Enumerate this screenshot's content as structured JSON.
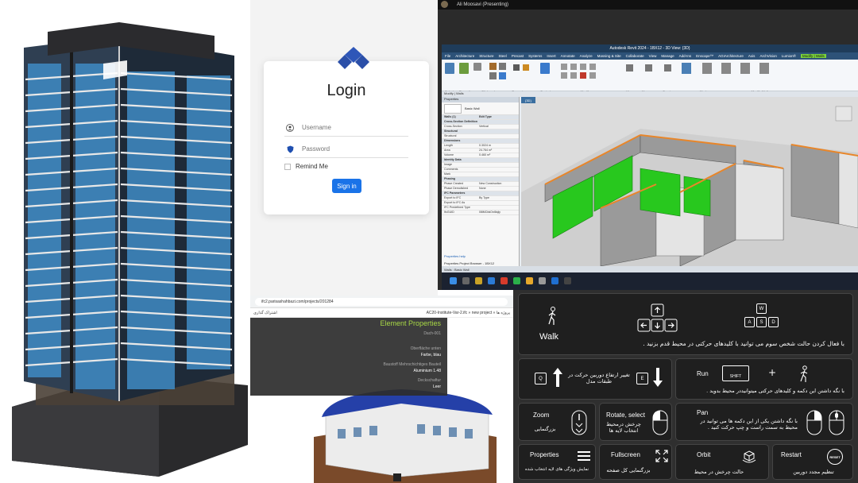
{
  "login": {
    "title": "Login",
    "username_placeholder": "Username",
    "password_placeholder": "Password",
    "remember_label": "Remind Me",
    "signin_label": "Sign in"
  },
  "meeting": {
    "presenter": "Ali Moosavi (Presenting)"
  },
  "revit": {
    "title": "Autodesk Revit 2024 - 1BX12 - 3D View: {3D}",
    "tabs": [
      "File",
      "Architecture",
      "Structure",
      "Steel",
      "Precast",
      "Systems",
      "Insert",
      "Annotate",
      "Analyze",
      "Massing & Site",
      "Collaborate",
      "View",
      "Manage",
      "Add-Ins",
      "Enscape™",
      "AGIArchitecture",
      "Axis",
      "ArchVision",
      "Lumion®",
      "Modify | Walls"
    ],
    "ribbon_groups": [
      "Select",
      "Properties",
      "Clipboard",
      "Geometry",
      "Controls",
      "Modify",
      "View",
      "Measure",
      "Create",
      "Mode",
      "Modify Wall"
    ],
    "subbar": "Modify | Walls",
    "view_tab": "{3D}",
    "properties_header": "Properties",
    "type_name": "Basic Wall",
    "property_rows": [
      {
        "k": "Walls (1)",
        "v": "Edit Type",
        "sec": true
      },
      {
        "k": "Cross-Section Definition",
        "v": "",
        "sec": true
      },
      {
        "k": "Cross-Section",
        "v": "Vertical",
        "sec": false
      },
      {
        "k": "Structural",
        "v": "",
        "sec": true
      },
      {
        "k": "Structural",
        "v": "",
        "sec": false
      },
      {
        "k": "Dimensions",
        "v": "",
        "sec": true
      },
      {
        "k": "Length",
        "v": "0.3024 m",
        "sec": false
      },
      {
        "k": "Area",
        "v": "24.764 m²",
        "sec": false
      },
      {
        "k": "Volume",
        "v": "0.460 m³",
        "sec": false
      },
      {
        "k": "Identity Data",
        "v": "",
        "sec": true
      },
      {
        "k": "Image",
        "v": "",
        "sec": false
      },
      {
        "k": "Comments",
        "v": "",
        "sec": false
      },
      {
        "k": "Mark",
        "v": "",
        "sec": false
      },
      {
        "k": "Phasing",
        "v": "",
        "sec": true
      },
      {
        "k": "Phase Created",
        "v": "New Construction",
        "sec": false
      },
      {
        "k": "Phase Demolished",
        "v": "None",
        "sec": false
      },
      {
        "k": "IFC Parameters",
        "v": "",
        "sec": true
      },
      {
        "k": "Export to IFC",
        "v": "By Type",
        "sec": false
      },
      {
        "k": "Export to IFC As",
        "v": "",
        "sec": false
      },
      {
        "k": "IFC Predefined Type",
        "v": "",
        "sec": false
      },
      {
        "k": "IfcGUID",
        "v": "0l8MCfaiOnl6sjiy",
        "sec": false
      }
    ],
    "properties_help": "Properties help",
    "bottom_tabs": "Properties   Project Browser - 1BX12",
    "status": "Walls : Basic Wall"
  },
  "viewer": {
    "url": "ifc2.parisashahbazi.com/projects/201284",
    "share_label": "اشتراک گذاری",
    "path": "AC20-Institute-Var-2.ifc » new project » پروژه ها",
    "panel_title": "Element Properties",
    "panel_subtitle": "Dach-001",
    "fields": [
      {
        "label": "Oberfläche unten",
        "value": "Farbe, blau"
      },
      {
        "label": "Baustoff Mehrschichtiges Bauteil",
        "value": "Aluminium 1.48"
      },
      {
        "label": "Deckschaftur",
        "value": "Leer"
      }
    ]
  },
  "help": {
    "walk": {
      "en": "Walk",
      "fa": "با فعال کردن حالت شخص سوم می توانید با کلیدهای حرکتی در محیط قدم بزنید ."
    },
    "walk_keys": [
      "W",
      "A",
      "S",
      "D"
    ],
    "height": {
      "fa": "تغییر ارتفاع دوربین حرکت در طبقات مدل",
      "keys": [
        "Q",
        "E"
      ]
    },
    "run": {
      "en": "Run",
      "fa": "با نگه داشتن این دکمه و کلیدهای حرکتی میتوانیددر محیط بدوید .",
      "key": "SHIFT"
    },
    "zoom": {
      "en": "Zoom",
      "fa": "بزرگنمایی"
    },
    "rotate": {
      "en": "Rotate, select",
      "fa": "چرخش درمحیط انتخاب لایه ها"
    },
    "pan": {
      "en": "Pan",
      "fa": "با نگه داشتن یکی از این دکمه ها می توانید در محیط به سمت راست و چپ حرکت کنید ."
    },
    "properties": {
      "en": "Properties",
      "fa": "نمایش ویژگی های لایه انتخاب شده"
    },
    "fullscreen": {
      "en": "Fullscreen",
      "fa": "بزرگنمایی کل صفحه"
    },
    "orbit": {
      "en": "Orbit",
      "fa": "حالت چرخش در محیط"
    },
    "restart": {
      "en": "Restart",
      "fa": "تنظیم مجدد دوربین",
      "badge": "RESET"
    }
  },
  "colors": {
    "accent": "#1a73e8",
    "revit_blue": "#1f3c5a",
    "wall_green": "#28c81e",
    "wall_orange": "#e8862a",
    "viewer_title": "#a8d846"
  }
}
